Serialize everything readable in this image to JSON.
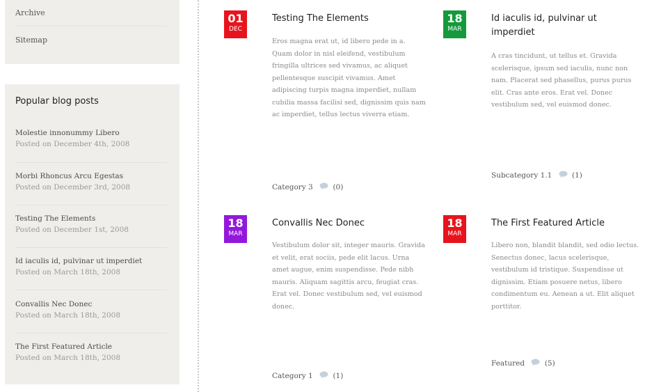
{
  "sidebar": {
    "pages": [
      {
        "label": "Archive"
      },
      {
        "label": "Sitemap"
      }
    ],
    "popular": {
      "title": "Popular blog posts",
      "items": [
        {
          "title": "Molestie innonummy Libero",
          "date": "Posted on December 4th, 2008"
        },
        {
          "title": "Morbi Rhoncus Arcu Egestas",
          "date": "Posted on December 3rd, 2008"
        },
        {
          "title": "Testing The Elements",
          "date": "Posted on December 1st, 2008"
        },
        {
          "title": "Id iaculis id, pulvinar ut imperdiet",
          "date": "Posted on March 18th, 2008"
        },
        {
          "title": "Convallis Nec Donec",
          "date": "Posted on March 18th, 2008"
        },
        {
          "title": "The First Featured Article",
          "date": "Posted on March 18th, 2008"
        }
      ]
    }
  },
  "articles": [
    {
      "day": "01",
      "month": "DEC",
      "badge_color": "#e8141d",
      "title": "Testing The Elements",
      "excerpt": "Eros magna erat ut, id libero pede in a. Quam dolor in nisl eleifend, vestibulum fringilla ultrices sed vivamus, ac aliquet pellentesque suscipit vivamus. Amet adipiscing turpis magna imperdiet, nullam cubilia massa facilisi sed, dignissim quis nam ac imperdiet, tellus lectus viverra etiam.",
      "category": "Category 3",
      "comments": "(0)",
      "comment_icon": "comment-bubble-icon"
    },
    {
      "day": "18",
      "month": "MAR",
      "badge_color": "#149a3c",
      "title": "Id iaculis id, pulvinar ut imperdiet",
      "excerpt": "A cras tincidunt, ut tellus et. Gravida scelerisque, ipsum sed iaculis, nunc non nam. Placerat sed phasellus, purus purus elit. Cras ante eros. Erat vel. Donec vestibulum sed, vel euismod donec.",
      "category": "Subcategory 1.1",
      "comments": "(1)",
      "comment_icon": "comment-bubble-icon"
    },
    {
      "day": "18",
      "month": "MAR",
      "badge_color": "#9418dc",
      "title": "Convallis Nec Donec",
      "excerpt": "Vestibulum dolor sit, integer mauris. Gravida et velit, erat sociis, pede elit lacus. Urna amet augue, enim suspendisse. Pede nibh mauris. Aliquam sagittis arcu, feugiat cras. Erat vel. Donec vestibulum sed, vel euismod donec.",
      "category": "Category 1",
      "comments": "(1)",
      "comment_icon": "comment-bubble-icon"
    },
    {
      "day": "18",
      "month": "MAR",
      "badge_color": "#e8141d",
      "title": "The First Featured Article",
      "excerpt": "Libero non, blandit blandit, sed odio lectus. Senectus donec, lacus scelerisque, vestibulum id tristique. Suspendisse ut dignissim. Etiam posuere netus, libero condimentum eu. Aenean a ut. Elit aliquet porttitor.",
      "category": "Featured",
      "comments": "(5)",
      "comment_icon": "comment-bubble-icon"
    }
  ]
}
